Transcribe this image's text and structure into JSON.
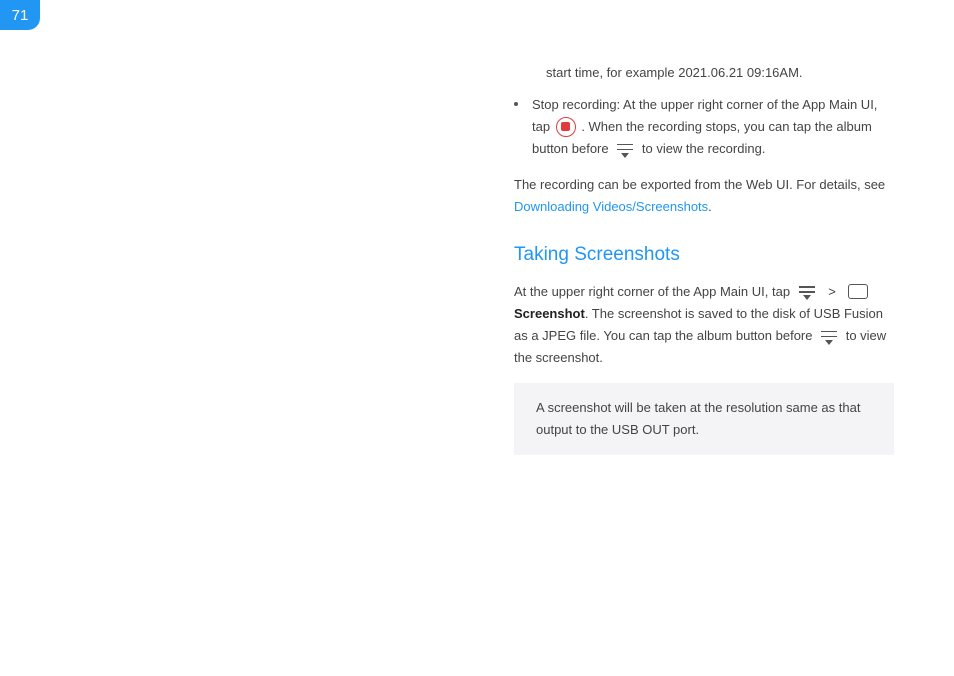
{
  "page_number": "71",
  "line1": "start time, for example 2021.06.21 09:16AM.",
  "bullet": {
    "p1a": "Stop recording: At the upper right corner of the App Main UI, tap ",
    "p1b": " . When the recording stops, you can tap the album button before ",
    "p1c": " to view the recording."
  },
  "export_para_a": "The recording can be exported from the Web UI. For details, see ",
  "export_link": "Downloading Videos/Screenshots",
  "export_para_b": ".",
  "section_heading": "Taking Screenshots",
  "ss_para": {
    "a": "At the upper right corner of the App Main UI, tap ",
    "sep": ">",
    "screenshot_label": "Screenshot",
    "b": ". The screenshot is saved to the disk of USB Fusion as a JPEG file. You can tap the album button before ",
    "c": " to view the screenshot."
  },
  "note": "A screenshot will be taken at the resolution same as that output to the USB OUT port."
}
